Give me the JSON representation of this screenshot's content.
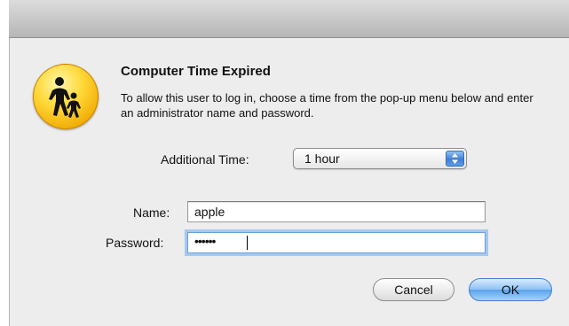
{
  "dialog": {
    "title": "Computer Time Expired",
    "message": "To allow this user to log in, choose a time from the pop-up menu below and enter an administrator name and password.",
    "icon": "parental-controls-icon"
  },
  "additional_time": {
    "label": "Additional Time:",
    "selected": "1 hour"
  },
  "name": {
    "label": "Name:",
    "value": "apple"
  },
  "password": {
    "label": "Password:",
    "masked_value": "••••••"
  },
  "buttons": {
    "cancel": "Cancel",
    "ok": "OK"
  },
  "colors": {
    "icon_yellow": "#ffd93a",
    "default_button_blue": "#5aa2ea",
    "focus_ring": "#a6c8f0"
  }
}
